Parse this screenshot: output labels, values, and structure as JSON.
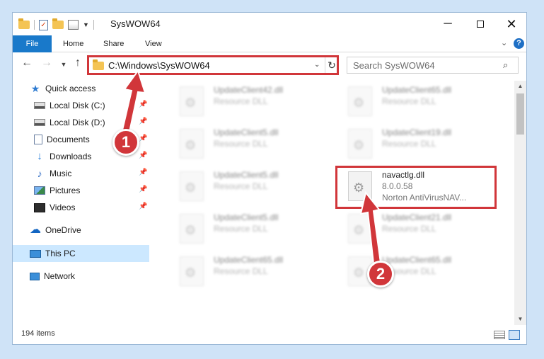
{
  "window": {
    "title": "SysWOW64",
    "controls": {
      "minimize": "─",
      "close": "✕"
    }
  },
  "ribbon": {
    "tabs": [
      "File",
      "Home",
      "Share",
      "View"
    ],
    "help": "?",
    "expand": "⌄"
  },
  "address_bar": {
    "path": "C:\\Windows\\SysWOW64",
    "search_placeholder": "Search SysWOW64"
  },
  "sidebar": {
    "items": [
      {
        "label": "Quick access",
        "icon": "star-icon",
        "pinned": false
      },
      {
        "label": "Local Disk (C:)",
        "icon": "disk-icon",
        "pinned": true
      },
      {
        "label": "Local Disk (D:)",
        "icon": "disk-icon",
        "pinned": true
      },
      {
        "label": "Documents",
        "icon": "documents-icon",
        "pinned": true
      },
      {
        "label": "Downloads",
        "icon": "downloads-icon",
        "pinned": true
      },
      {
        "label": "Music",
        "icon": "music-icon",
        "pinned": true
      },
      {
        "label": "Pictures",
        "icon": "pictures-icon",
        "pinned": true
      },
      {
        "label": "Videos",
        "icon": "videos-icon",
        "pinned": true
      },
      {
        "label": "OneDrive",
        "icon": "onedrive-icon",
        "pinned": false
      },
      {
        "label": "This PC",
        "icon": "computer-icon",
        "pinned": false,
        "selected": true
      },
      {
        "label": "Network",
        "icon": "network-icon",
        "pinned": false
      }
    ]
  },
  "files": [
    {
      "name": "UpdateClient42.dll",
      "desc": "Resource DLL",
      "blurred": true
    },
    {
      "name": "UpdateClient65.dll",
      "desc": "Resource DLL",
      "blurred": true
    },
    {
      "name": "UpdateClient5.dll",
      "desc": "Resource DLL",
      "blurred": true
    },
    {
      "name": "UpdateClient19.dll",
      "desc": "Resource DLL",
      "blurred": true
    },
    {
      "name": "UpdateClient5.dll",
      "desc": "Resource DLL",
      "blurred": true
    },
    {
      "name": "navactlg.dll",
      "desc": "8.0.0.58",
      "extra": "Norton AntiVirusNAV...",
      "blurred": false
    },
    {
      "name": "UpdateClient5.dll",
      "desc": "Resource DLL",
      "blurred": true
    },
    {
      "name": "UpdateClient21.dll",
      "desc": "Resource DLL",
      "blurred": true
    },
    {
      "name": "UpdateClient65.dll",
      "desc": "Resource DLL",
      "blurred": true
    },
    {
      "name": "UpdateClient65.dll",
      "desc": "Resource DLL",
      "blurred": true
    }
  ],
  "status": {
    "count": "194 items"
  },
  "annotations": {
    "step1": "1",
    "step2": "2",
    "color": "#d1363a"
  }
}
